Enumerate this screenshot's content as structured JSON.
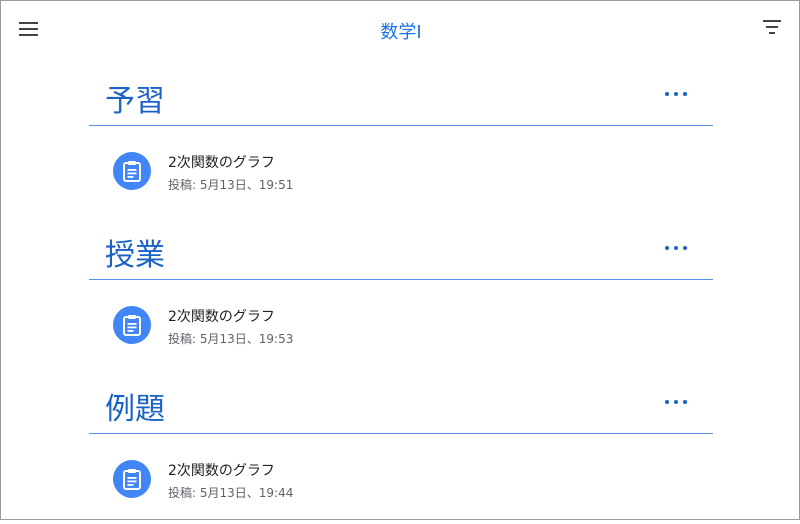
{
  "header": {
    "title": "数学I",
    "menu_icon": "hamburger-menu-icon",
    "filter_icon": "filter-icon"
  },
  "accent_color": "#1a62c6",
  "icon_color": "#4285f4",
  "sections": [
    {
      "title": "予習",
      "items": [
        {
          "title": "2次関数のグラフ",
          "meta": "投稿: 5月13日、19:51",
          "icon": "assignment-icon"
        }
      ]
    },
    {
      "title": "授業",
      "items": [
        {
          "title": "2次関数のグラフ",
          "meta": "投稿: 5月13日、19:53",
          "icon": "assignment-icon"
        }
      ]
    },
    {
      "title": "例題",
      "items": [
        {
          "title": "2次関数のグラフ",
          "meta": "投稿: 5月13日、19:44",
          "icon": "assignment-icon"
        }
      ]
    }
  ]
}
